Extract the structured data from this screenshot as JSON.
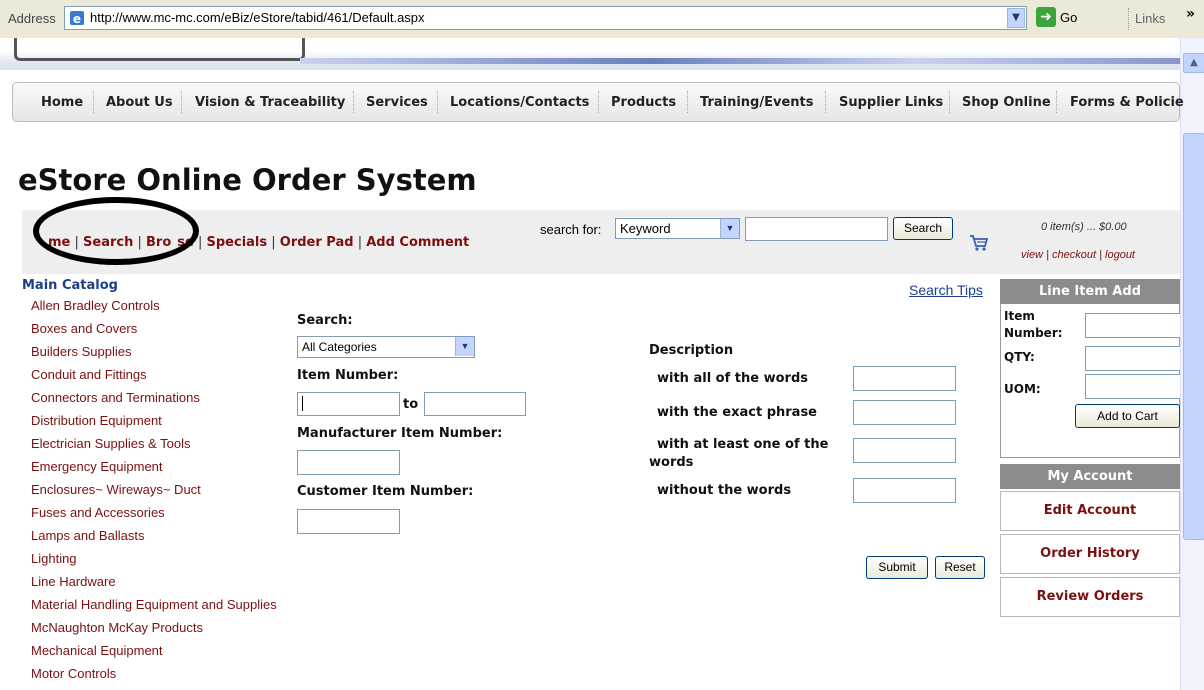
{
  "browser": {
    "address_label": "Address",
    "url": "http://www.mc-mc.com/eBiz/eStore/tabid/461/Default.aspx",
    "go_label": "Go",
    "links_label": "Links",
    "chevron": "»"
  },
  "nav": {
    "items": [
      "Home",
      "About Us",
      "Vision & Traceability",
      "Services",
      "Locations/Contacts",
      "Products",
      "Training/Events",
      "Supplier Links",
      "Shop Online",
      "Forms & Policie"
    ]
  },
  "page_title": "eStore Online Order System",
  "store_toolbar": {
    "links": [
      "me",
      "Search",
      "Bro",
      "se",
      "Specials",
      "Order Pad",
      "Add Comment"
    ],
    "search_for_label": "search for:",
    "search_type": "Keyword",
    "search_button": "Search",
    "cart_summary": "0 item(s) ... $0.00",
    "cart_links": [
      "view",
      "checkout",
      "logout"
    ]
  },
  "catalog": {
    "heading": "Main Catalog",
    "items": [
      "Allen Bradley Controls",
      "Boxes and Covers",
      "Builders Supplies",
      "Conduit and Fittings",
      "Connectors and Terminations",
      "Distribution Equipment",
      "Electrician Supplies & Tools",
      "Emergency Equipment",
      "Enclosures~ Wireways~ Duct",
      "Fuses and Accessories",
      "Lamps and Ballasts",
      "Lighting",
      "Line Hardware",
      "Material Handling Equipment and Supplies",
      "McNaughton McKay Products",
      "Mechanical Equipment",
      "Motor Controls"
    ]
  },
  "search_form": {
    "search_tips": "Search Tips",
    "search_label": "Search:",
    "category_value": "All Categories",
    "item_number_label": "Item Number:",
    "to_label": "to",
    "mfr_item_label": "Manufacturer Item Number:",
    "customer_item_label": "Customer Item Number:",
    "description_label": "Description",
    "all_words_label": "with all of the words",
    "exact_phrase_label": "with the exact phrase",
    "at_least_label_1": "with at least one of the",
    "at_least_label_2": "words",
    "without_label": "without the words",
    "submit_label": "Submit",
    "reset_label": "Reset"
  },
  "line_item_add": {
    "heading": "Line Item Add",
    "item_label_1": "Item",
    "item_label_2": "Number:",
    "qty_label": "QTY:",
    "uom_label": "UOM:",
    "add_button": "Add to Cart"
  },
  "my_account": {
    "heading": "My Account",
    "items": [
      "Edit Account",
      "Order History",
      "Review Orders"
    ]
  },
  "colors": {
    "link_maroon": "#7a1010",
    "heading_blue": "#1b3f8b",
    "panel_gray": "#8c8c8c"
  }
}
